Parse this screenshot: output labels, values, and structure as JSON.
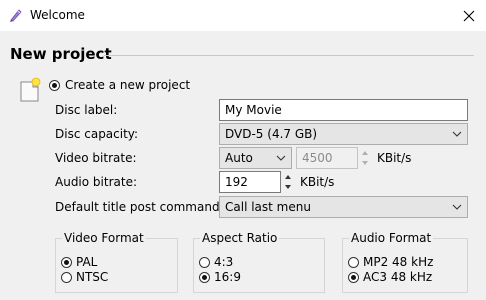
{
  "window": {
    "title": "Welcome"
  },
  "section": {
    "title": "New project"
  },
  "create_option": {
    "label": "Create a new project",
    "selected": true
  },
  "form": {
    "disc_label": {
      "label": "Disc label:",
      "value": "My Movie"
    },
    "disc_capacity": {
      "label": "Disc capacity:",
      "value": "DVD-5 (4.7 GB)"
    },
    "video_bitrate": {
      "label": "Video bitrate:",
      "mode": "Auto",
      "value": "4500",
      "unit": "KBit/s"
    },
    "audio_bitrate": {
      "label": "Audio bitrate:",
      "value": "192",
      "unit": "KBit/s"
    },
    "post_command": {
      "label": "Default title post command:",
      "value": "Call last menu"
    }
  },
  "groups": {
    "video_format": {
      "title": "Video Format",
      "options": [
        "PAL",
        "NTSC"
      ],
      "selected": "PAL"
    },
    "aspect_ratio": {
      "title": "Aspect Ratio",
      "options": [
        "4:3",
        "16:9"
      ],
      "selected": "16:9"
    },
    "audio_format": {
      "title": "Audio Format",
      "options": [
        "MP2 48 kHz",
        "AC3 48 kHz"
      ],
      "selected": "AC3 48 kHz"
    }
  },
  "icons": {
    "app": "pen-icon",
    "close": "close-icon",
    "project": "new-document-icon"
  },
  "colors": {
    "titlebar": "#ffffff",
    "background": "#f0f0f0",
    "field_border": "#7a7a7a"
  }
}
